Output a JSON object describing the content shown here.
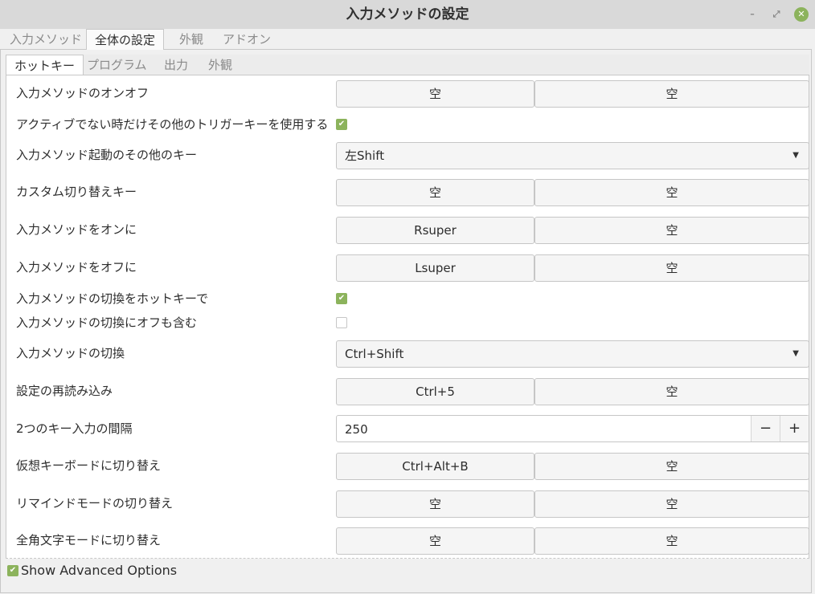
{
  "window": {
    "title": "入力メソッドの設定",
    "minimize": "–",
    "restore": "⤢",
    "close": "✕"
  },
  "outer_tabs": [
    "入力メソッド",
    "全体の設定",
    "外観",
    "アドオン"
  ],
  "inner_tabs": [
    "ホットキー",
    "プログラム",
    "出力",
    "外観"
  ],
  "rows": {
    "r0": {
      "label": "入力メソッドのオンオフ",
      "b1": "空",
      "b2": "空"
    },
    "r1": {
      "label": "アクティブでない時だけその他のトリガーキーを使用する",
      "checked": true
    },
    "r2": {
      "label": "入力メソッド起動のその他のキー",
      "value": "左Shift"
    },
    "r3": {
      "label": "カスタム切り替えキー",
      "b1": "空",
      "b2": "空"
    },
    "r4": {
      "label": "入力メソッドをオンに",
      "b1": "Rsuper",
      "b2": "空"
    },
    "r5": {
      "label": "入力メソッドをオフに",
      "b1": "Lsuper",
      "b2": "空"
    },
    "r6": {
      "label": "入力メソッドの切換をホットキーで",
      "checked": true
    },
    "r7": {
      "label": "入力メソッドの切換にオフも含む",
      "checked": false
    },
    "r8": {
      "label": "入力メソッドの切換",
      "value": "Ctrl+Shift"
    },
    "r9": {
      "label": "設定の再読み込み",
      "b1": "Ctrl+5",
      "b2": "空"
    },
    "r10": {
      "label": "2つのキー入力の間隔",
      "value": "250",
      "minus": "−",
      "plus": "+"
    },
    "r11": {
      "label": "仮想キーボードに切り替え",
      "b1": "Ctrl+Alt+B",
      "b2": "空"
    },
    "r12": {
      "label": "リマインドモードの切り替え",
      "b1": "空",
      "b2": "空"
    },
    "r13": {
      "label": "全角文字モードに切り替え",
      "b1": "空",
      "b2": "空"
    }
  },
  "footer": {
    "advanced_label": "Show Advanced Options",
    "advanced_checked": true
  },
  "colors": {
    "accent": "#8cb35c"
  }
}
